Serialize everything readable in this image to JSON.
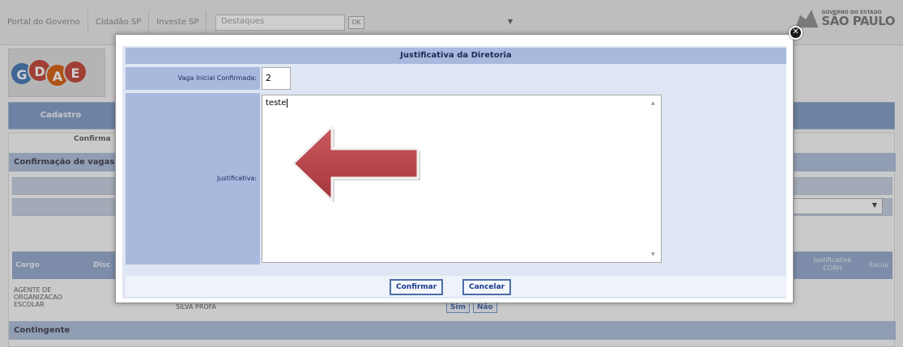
{
  "topbar": {
    "nav": [
      "Portal do Governo",
      "Cidadão SP",
      "Investe SP"
    ],
    "destaques": "Destaques",
    "ok": "OK",
    "gov_small": "GOVERNO DO ESTADO",
    "gov_big": "SÃO PAULO"
  },
  "logo": {
    "letters": [
      "G",
      "D",
      "A",
      "E"
    ]
  },
  "menu": {
    "cadastro": "Cadastro"
  },
  "background": {
    "sub_tab": "Confirma",
    "section_title": "Confirmação de vagas",
    "table_header_first": "Cargo",
    "table_header_disc": "Disc",
    "table_header_right": "Justificativa CGRH",
    "table_header_excl": "Exclur",
    "cargo_value": "AGENTE DE ORGANIZACAO ESCOLAR",
    "silva": "SILVA PROFA",
    "sim": "Sim",
    "nao": "Não",
    "contingente": "Contingente"
  },
  "modal": {
    "title": "Justificativa da Diretoria",
    "vaga_label": "Vaga Inicial Confirmada:",
    "vaga_value": "2",
    "just_label": "Justificativa:",
    "just_value": "teste",
    "confirm": "Confirmar",
    "cancel": "Cancelar"
  },
  "colors": {
    "header_blue": "#a8b9de",
    "modal_bg": "#dfe6f3",
    "arrow_red": "#b8434a"
  },
  "icons": {
    "close": "close-icon",
    "arrow": "red-arrow-annotation",
    "dropdown": "chevron-down-icon"
  }
}
